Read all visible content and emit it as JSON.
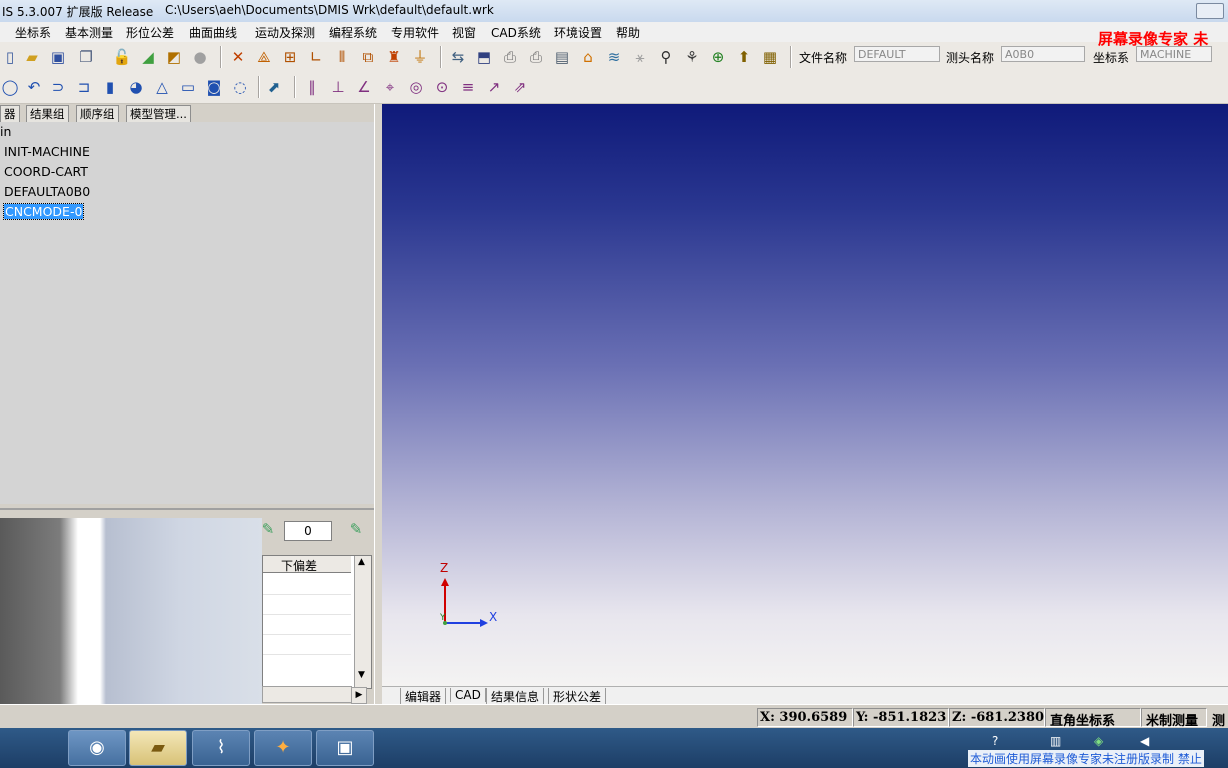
{
  "window": {
    "title": "IS 5.3.007 扩展版 Release",
    "path": "C:\\Users\\aeh\\Documents\\DMIS Wrk\\default\\default.wrk"
  },
  "menu": [
    "坐标系",
    "基本测量",
    "形位公差",
    "曲面曲线",
    "运动及探测",
    "编程系统",
    "专用软件",
    "视窗",
    "CAD系统",
    "环境设置",
    "帮助"
  ],
  "toolbar_fields": {
    "file_label": "文件名称",
    "file_value": "DEFAULT",
    "probe_label": "测头名称",
    "probe_value": "A0B0",
    "coord_label": "坐标系",
    "coord_value": "MACHINE"
  },
  "watermark_top": "屏幕录像专家  未",
  "left_tabs": [
    "器",
    "结果组",
    "顺序组",
    "模型管理..."
  ],
  "tree": {
    "root": "in",
    "items": [
      "INIT-MACHINE",
      "COORD-CART",
      "DEFAULTA0B0",
      "CNCMODE-0"
    ],
    "selected_index": 3
  },
  "counter": "0",
  "grid": {
    "header": "下偏差"
  },
  "axes": {
    "z": "Z",
    "y": "Y",
    "x": "X"
  },
  "view_tabs": [
    "编辑器",
    "CAD",
    "结果信息",
    "形状公差"
  ],
  "status": {
    "x": "X: 390.6589",
    "y": "Y: -851.1823",
    "z": "Z: -681.2380",
    "coord_mode": "直角坐标系",
    "unit": "米制测量",
    "extra": "测"
  },
  "taskbar": {
    "apps": [
      "dmis-icon",
      "folder-icon",
      "app-icon",
      "media-icon",
      "camera-icon"
    ],
    "tray_text": "本动画使用屏幕录像专家未注册版录制  禁止"
  }
}
